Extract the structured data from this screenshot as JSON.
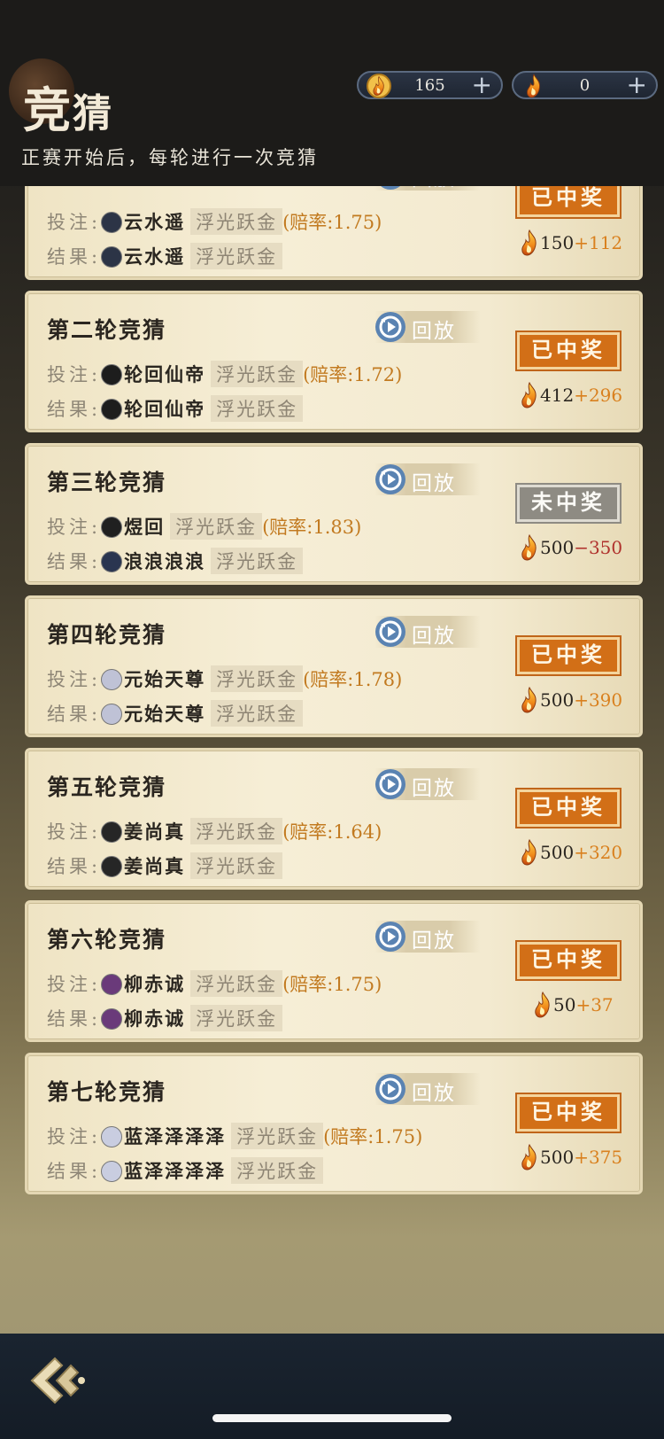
{
  "header": {
    "title_big": "竞",
    "title_small": "猜",
    "subtitle": "正赛开始后，每轮进行一次竞猜",
    "currency_1": {
      "icon": "flame-coin-icon",
      "value": "165",
      "plus": "+"
    },
    "currency_2": {
      "icon": "flame-ticket-icon",
      "value": "0",
      "plus": "+"
    }
  },
  "labels": {
    "bet": "投注:",
    "result": "结果:",
    "replay": "回放",
    "odds_prefix": "(赔率",
    "odds_suffix": ")"
  },
  "rounds": [
    {
      "title": "",
      "bet_name": "云水遥",
      "bet_horse": "浮光跃金",
      "odds": ":1.75",
      "result_name": "云水遥",
      "result_horse": "浮光跃金",
      "status": "已中奖",
      "stake": "150",
      "delta": "+112"
    },
    {
      "title": "第二轮竞猜",
      "bet_name": "轮回仙帝",
      "bet_horse": "浮光跃金",
      "odds": ":1.72",
      "result_name": "轮回仙帝",
      "result_horse": "浮光跃金",
      "status": "已中奖",
      "stake": "412",
      "delta": "+296"
    },
    {
      "title": "第三轮竞猜",
      "bet_name": "煜回",
      "bet_horse": "浮光跃金",
      "odds": ":1.83",
      "result_name": "浪浪浪浪",
      "result_horse": "浮光跃金",
      "status": "未中奖",
      "stake": "500",
      "delta": "−350"
    },
    {
      "title": "第四轮竞猜",
      "bet_name": "元始天尊",
      "bet_horse": "浮光跃金",
      "odds": ":1.78",
      "result_name": "元始天尊",
      "result_horse": "浮光跃金",
      "status": "已中奖",
      "stake": "500",
      "delta": "+390"
    },
    {
      "title": "第五轮竞猜",
      "bet_name": "姜尚真",
      "bet_horse": "浮光跃金",
      "odds": ":1.64",
      "result_name": "姜尚真",
      "result_horse": "浮光跃金",
      "status": "已中奖",
      "stake": "500",
      "delta": "+320"
    },
    {
      "title": "第六轮竞猜",
      "bet_name": "柳赤诚",
      "bet_horse": "浮光跃金",
      "odds": ":1.75",
      "result_name": "柳赤诚",
      "result_horse": "浮光跃金",
      "status": "已中奖",
      "stake": "50",
      "delta": "+37"
    },
    {
      "title": "第七轮竞猜",
      "bet_name": "蓝泽泽泽泽",
      "bet_horse": "浮光跃金",
      "odds": ":1.75",
      "result_name": "蓝泽泽泽泽",
      "result_horse": "浮光跃金",
      "status": "已中奖",
      "stake": "500",
      "delta": "+375"
    }
  ],
  "colors": {
    "gain": "#d9801e",
    "loss": "#b0322d",
    "win_badge": "#d26f17",
    "lose_badge": "#8e8b83",
    "odds": "#c27a20"
  },
  "footer": {
    "back_icon": "back-arrow-icon"
  }
}
